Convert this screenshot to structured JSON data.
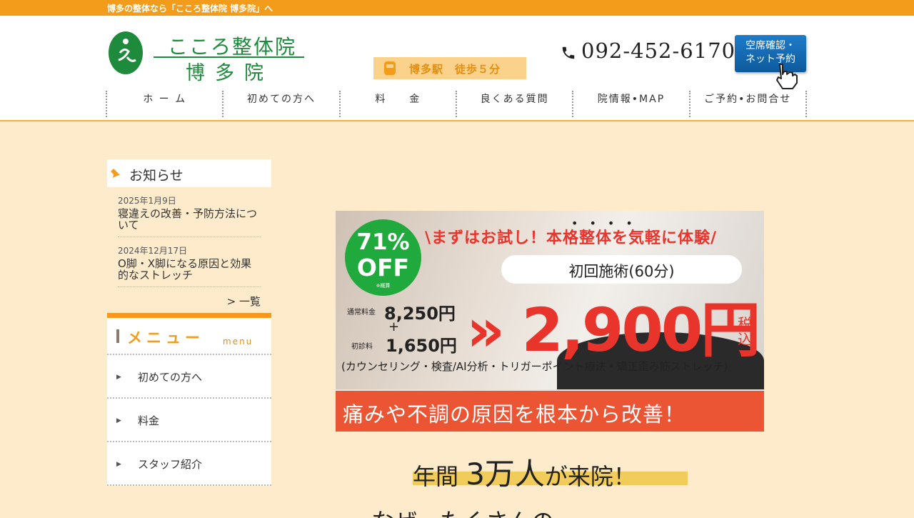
{
  "topbar": {
    "text": "博多の整体なら「こころ整体院 博多院」へ"
  },
  "logo": {
    "line1": "こころ整体院",
    "line2": "博多院"
  },
  "access": {
    "text": "博多駅　徒歩５分"
  },
  "phone": {
    "number": "092-452-6170"
  },
  "reserve_button": {
    "line1": "空席確認・",
    "line2": "ネット予約"
  },
  "gnav": [
    "ホ ー ム",
    "初めての方へ",
    "料　　金",
    "良くある質問",
    "院情報•MAP",
    "ご予約•お問合せ"
  ],
  "news": {
    "heading": "お知らせ",
    "items": [
      {
        "date": "2025年1月9日",
        "title": "寝違えの改善・予防方法について"
      },
      {
        "date": "2024年12月17日",
        "title": "O脚・X脚になる原因と効果的なストレッチ"
      }
    ],
    "more": "> 一覧"
  },
  "menu": {
    "heading": "メニュー",
    "sub": "menu",
    "items": [
      "初めての方へ",
      "料金",
      "スタッフ紹介"
    ]
  },
  "banner": {
    "dots": "••••",
    "off_percent": "71%",
    "off_label": "OFF",
    "off_note": "※概算",
    "catch": "\\まずはお試し！本格整体を気軽に体験/",
    "bubble": "初回施術(60分)",
    "regular_label": "通常料金",
    "regular_value": "8,250円",
    "plus": "+",
    "initial_label": "初診料",
    "initial_value": "1,650円",
    "price": "» 2,900円",
    "tax": "税込",
    "detail": "(カウンセリング・検査/AI分析・トリガーポイント療法・矯正歪み筋ストレッチ)",
    "ribbon": "痛みや不調の原因を根本から改善！"
  },
  "visitors": {
    "pre": "年間 ",
    "big": "3万人",
    "post": "が来院！"
  },
  "next_heading": "なぜ、たくさんの"
}
